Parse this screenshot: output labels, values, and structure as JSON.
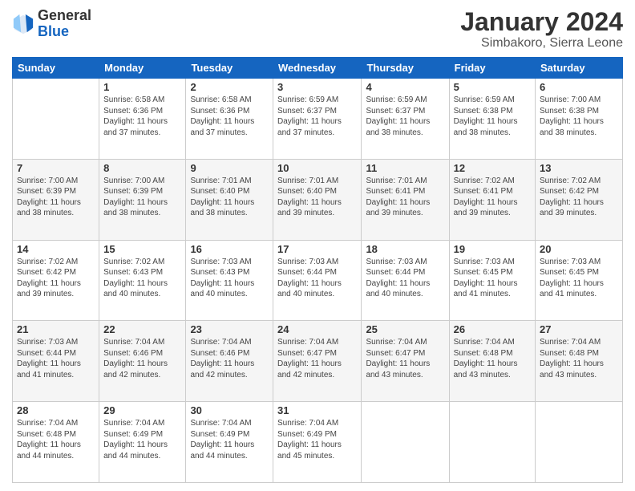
{
  "header": {
    "logo_line1": "General",
    "logo_line2": "Blue",
    "calendar_title": "January 2024",
    "calendar_subtitle": "Simbakoro, Sierra Leone"
  },
  "weekdays": [
    "Sunday",
    "Monday",
    "Tuesday",
    "Wednesday",
    "Thursday",
    "Friday",
    "Saturday"
  ],
  "weeks": [
    [
      {
        "day": "",
        "info": ""
      },
      {
        "day": "1",
        "info": "Sunrise: 6:58 AM\nSunset: 6:36 PM\nDaylight: 11 hours\nand 37 minutes."
      },
      {
        "day": "2",
        "info": "Sunrise: 6:58 AM\nSunset: 6:36 PM\nDaylight: 11 hours\nand 37 minutes."
      },
      {
        "day": "3",
        "info": "Sunrise: 6:59 AM\nSunset: 6:37 PM\nDaylight: 11 hours\nand 37 minutes."
      },
      {
        "day": "4",
        "info": "Sunrise: 6:59 AM\nSunset: 6:37 PM\nDaylight: 11 hours\nand 38 minutes."
      },
      {
        "day": "5",
        "info": "Sunrise: 6:59 AM\nSunset: 6:38 PM\nDaylight: 11 hours\nand 38 minutes."
      },
      {
        "day": "6",
        "info": "Sunrise: 7:00 AM\nSunset: 6:38 PM\nDaylight: 11 hours\nand 38 minutes."
      }
    ],
    [
      {
        "day": "7",
        "info": ""
      },
      {
        "day": "8",
        "info": "Sunrise: 7:00 AM\nSunset: 6:39 PM\nDaylight: 11 hours\nand 38 minutes."
      },
      {
        "day": "9",
        "info": "Sunrise: 7:01 AM\nSunset: 6:40 PM\nDaylight: 11 hours\nand 38 minutes."
      },
      {
        "day": "10",
        "info": "Sunrise: 7:01 AM\nSunset: 6:40 PM\nDaylight: 11 hours\nand 39 minutes."
      },
      {
        "day": "11",
        "info": "Sunrise: 7:01 AM\nSunset: 6:41 PM\nDaylight: 11 hours\nand 39 minutes."
      },
      {
        "day": "12",
        "info": "Sunrise: 7:02 AM\nSunset: 6:41 PM\nDaylight: 11 hours\nand 39 minutes."
      },
      {
        "day": "13",
        "info": "Sunrise: 7:02 AM\nSunset: 6:42 PM\nDaylight: 11 hours\nand 39 minutes."
      }
    ],
    [
      {
        "day": "14",
        "info": ""
      },
      {
        "day": "15",
        "info": "Sunrise: 7:02 AM\nSunset: 6:43 PM\nDaylight: 11 hours\nand 40 minutes."
      },
      {
        "day": "16",
        "info": "Sunrise: 7:03 AM\nSunset: 6:43 PM\nDaylight: 11 hours\nand 40 minutes."
      },
      {
        "day": "17",
        "info": "Sunrise: 7:03 AM\nSunset: 6:44 PM\nDaylight: 11 hours\nand 40 minutes."
      },
      {
        "day": "18",
        "info": "Sunrise: 7:03 AM\nSunset: 6:44 PM\nDaylight: 11 hours\nand 40 minutes."
      },
      {
        "day": "19",
        "info": "Sunrise: 7:03 AM\nSunset: 6:45 PM\nDaylight: 11 hours\nand 41 minutes."
      },
      {
        "day": "20",
        "info": "Sunrise: 7:03 AM\nSunset: 6:45 PM\nDaylight: 11 hours\nand 41 minutes."
      }
    ],
    [
      {
        "day": "21",
        "info": ""
      },
      {
        "day": "22",
        "info": "Sunrise: 7:04 AM\nSunset: 6:46 PM\nDaylight: 11 hours\nand 42 minutes."
      },
      {
        "day": "23",
        "info": "Sunrise: 7:04 AM\nSunset: 6:46 PM\nDaylight: 11 hours\nand 42 minutes."
      },
      {
        "day": "24",
        "info": "Sunrise: 7:04 AM\nSunset: 6:47 PM\nDaylight: 11 hours\nand 42 minutes."
      },
      {
        "day": "25",
        "info": "Sunrise: 7:04 AM\nSunset: 6:47 PM\nDaylight: 11 hours\nand 43 minutes."
      },
      {
        "day": "26",
        "info": "Sunrise: 7:04 AM\nSunset: 6:48 PM\nDaylight: 11 hours\nand 43 minutes."
      },
      {
        "day": "27",
        "info": "Sunrise: 7:04 AM\nSunset: 6:48 PM\nDaylight: 11 hours\nand 43 minutes."
      }
    ],
    [
      {
        "day": "28",
        "info": "Sunrise: 7:04 AM\nSunset: 6:48 PM\nDaylight: 11 hours\nand 44 minutes."
      },
      {
        "day": "29",
        "info": "Sunrise: 7:04 AM\nSunset: 6:49 PM\nDaylight: 11 hours\nand 44 minutes."
      },
      {
        "day": "30",
        "info": "Sunrise: 7:04 AM\nSunset: 6:49 PM\nDaylight: 11 hours\nand 44 minutes."
      },
      {
        "day": "31",
        "info": "Sunrise: 7:04 AM\nSunset: 6:49 PM\nDaylight: 11 hours\nand 45 minutes."
      },
      {
        "day": "",
        "info": ""
      },
      {
        "day": "",
        "info": ""
      },
      {
        "day": "",
        "info": ""
      }
    ]
  ],
  "week1_sun_info": "Sunrise: 7:00 AM\nSunset: 6:39 PM\nDaylight: 11 hours\nand 38 minutes.",
  "week3_sun_info": "Sunrise: 7:02 AM\nSunset: 6:42 PM\nDaylight: 11 hours\nand 39 minutes.",
  "week4_sun_info": "Sunrise: 7:03 AM\nSunset: 6:44 PM\nDaylight: 11 hours\nand 41 minutes."
}
